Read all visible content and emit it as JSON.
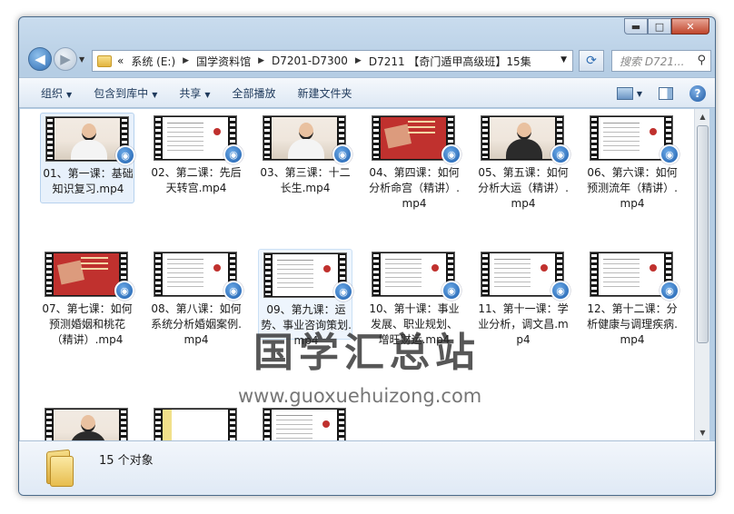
{
  "window": {
    "minimize": "▬",
    "maximize": "□",
    "close": "✕"
  },
  "address": {
    "overflow": "«",
    "crumbs": [
      "系统 (E:)",
      "国学资料馆",
      "D7201-D7300",
      "D7211 【奇门遁甲高级班】15集"
    ]
  },
  "search": {
    "placeholder": "搜索 D721..."
  },
  "toolbar": {
    "organize": "组织",
    "include_library": "包含到库中",
    "share": "共享",
    "play_all": "全部播放",
    "new_folder": "新建文件夹",
    "help": "?"
  },
  "files": [
    "01、第一课：基础知识复习.mp4",
    "02、第二课：先后天转宫.mp4",
    "03、第三课：十二长生.mp4",
    "04、第四课：如何分析命宫（精讲）.mp4",
    "05、第五课：如何分析大运（精讲）.mp4",
    "06、第六课：如何预测流年（精讲）.mp4",
    "07、第七课：如何预测婚姻和桃花（精讲）.mp4",
    "08、第八课：如何系统分析婚姻案例.mp4",
    "09、第九课：运势、事业咨询策划.mp4",
    "10、第十课：事业发展、职业规划、增旺财运.mp4",
    "11、第十一课：学业分析，调文昌.mp4",
    "12、第十二课：分析健康与调理疾病.mp4"
  ],
  "watermark": {
    "title": "国学汇总站",
    "url": "www.guoxuehuizong.com"
  },
  "details": {
    "count": "15 个对象"
  }
}
